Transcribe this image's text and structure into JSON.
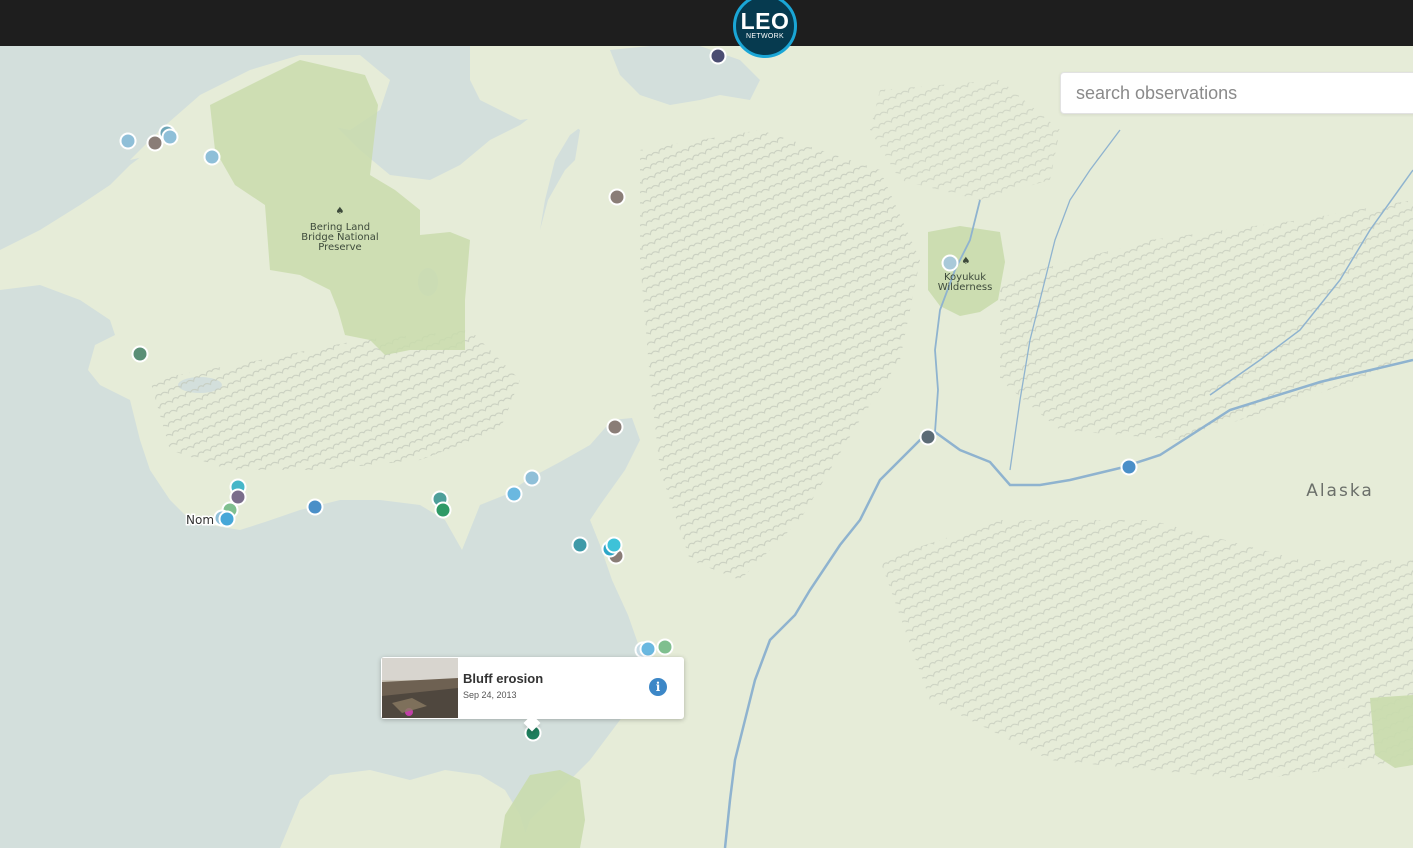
{
  "header": {
    "logo_main": "LEO",
    "logo_sub": "NETWORK"
  },
  "search": {
    "placeholder": "search observations",
    "value": ""
  },
  "map_labels": {
    "bering_line1": "Bering Land",
    "bering_line2": "Bridge National",
    "bering_line3": "Preserve",
    "koyukuk_line1": "Koyukuk",
    "koyukuk_line2": "Wilderness",
    "alaska": "Alaska",
    "nome": "Nome"
  },
  "popup": {
    "title": "Bluff erosion",
    "date": "Sep 24, 2013",
    "info_icon": "i"
  },
  "colors": {
    "land": "#e6ecd8",
    "water": "#d3dfdc",
    "park": "#c9dcad",
    "river": "#8fb3cf",
    "marker_light_blue": "#8fbfd8",
    "marker_gray_brown": "#8a7d77",
    "marker_teal": "#4e9f9a",
    "marker_green": "#2f9a66",
    "marker_blue": "#4a8fc8",
    "marker_purple": "#7a6d8b",
    "marker_navy": "#4b4d72",
    "info_blue": "#3c87c7"
  }
}
